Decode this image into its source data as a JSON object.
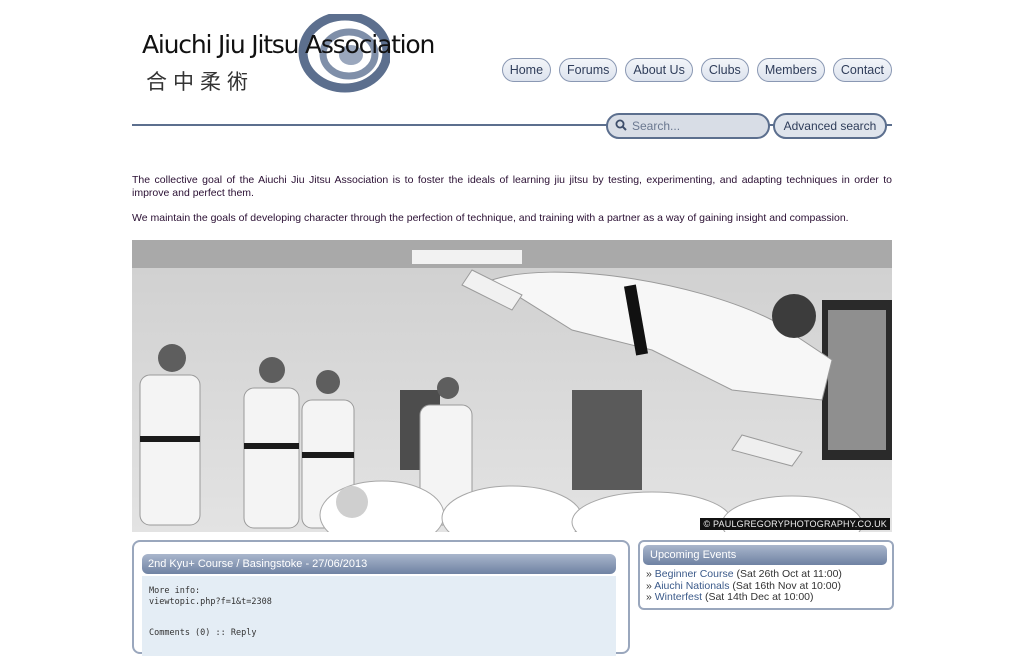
{
  "logo": {
    "title": "Aiuchi Jiu Jitsu Association",
    "cjk": "合中柔術"
  },
  "nav": {
    "items": [
      {
        "label": "Home"
      },
      {
        "label": "Forums"
      },
      {
        "label": "About Us"
      },
      {
        "label": "Clubs"
      },
      {
        "label": "Members"
      },
      {
        "label": "Contact"
      }
    ]
  },
  "search": {
    "placeholder": "Search...",
    "advanced_label": "Advanced search"
  },
  "intro": {
    "p1": "The collective goal of the Aiuchi Jiu Jitsu Association is to foster the ideals of learning jiu jitsu by testing, experimenting, and adapting techniques in order to improve and perfect them.",
    "p2": "We maintain the goals of developing character through the perfection of technique, and training with a partner as a way of gaining insight and compassion."
  },
  "hero": {
    "credit": "© PAULGREGORYPHOTOGRAPHY.CO.UK"
  },
  "news": {
    "title": "2nd Kyu+ Course / Basingstoke - 27/06/2013",
    "more_info_label": "More info:",
    "link": "viewtopic.php?f=1&t=2308",
    "comments": "Comments (0)",
    "separator": " :: ",
    "reply": "Reply"
  },
  "events": {
    "title": "Upcoming Events",
    "items": [
      {
        "name": "Beginner Course",
        "when": "(Sat 26th Oct at 11:00)"
      },
      {
        "name": "Aiuchi Nationals",
        "when": "(Sat 16th Nov at 10:00)"
      },
      {
        "name": "Winterfest",
        "when": "(Sat 14th Dec at 10:00)"
      }
    ],
    "bullet": "»"
  },
  "colors": {
    "accent": "#5c6f8e",
    "header_gradient_top": "#a9b6cc",
    "header_gradient_bottom": "#6f82a3",
    "link": "#3b5a8a"
  }
}
